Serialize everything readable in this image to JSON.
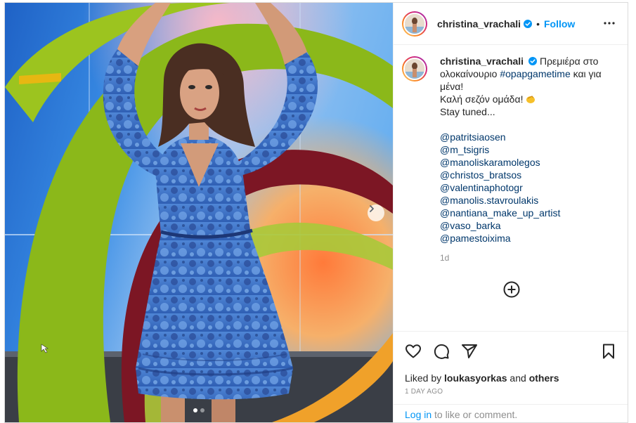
{
  "post": {
    "username": "christina_vrachali",
    "follow_label": "Follow",
    "bullet": "•",
    "caption": {
      "text_before": "Πρεμιέρα στο ολοκαίνουριο ",
      "hashtag": "#opapgametime",
      "text_after": " και για μένα!",
      "line2": "Καλή σεζόν ομάδα! ",
      "line3": "Stay tuned...",
      "mentions": [
        "@patritsiaosen",
        "@m_tsigris",
        "@manoliskaramolegos",
        "@christos_bratsos",
        "@valentinaphotogr",
        "@manolis.stavroulakis",
        "@nantiana_make_up_artist",
        "@vaso_barka",
        "@pamestoixima"
      ],
      "time_ago": "1d"
    },
    "likes": {
      "prefix": "Liked by ",
      "user": "loukasyorkas",
      "middle": " and ",
      "others": "others"
    },
    "date": "1 DAY AGO",
    "login": {
      "link": "Log in",
      "rest": " to like or comment."
    },
    "carousel": {
      "slides": 2,
      "active_index": 0
    },
    "icons": {
      "more": "more-options-icon",
      "like": "heart-icon",
      "comment": "comment-icon",
      "share": "share-icon",
      "save": "bookmark-icon",
      "add_comment": "add-comment-icon",
      "next": "chevron-right-icon",
      "verified": "verified-badge-icon",
      "emoji": "clapping-hand-emoji"
    }
  },
  "colors": {
    "link": "#00376b",
    "follow": "#0095f6",
    "verified": "#0095f6",
    "muted": "#8e8e8e",
    "text": "#262626"
  }
}
